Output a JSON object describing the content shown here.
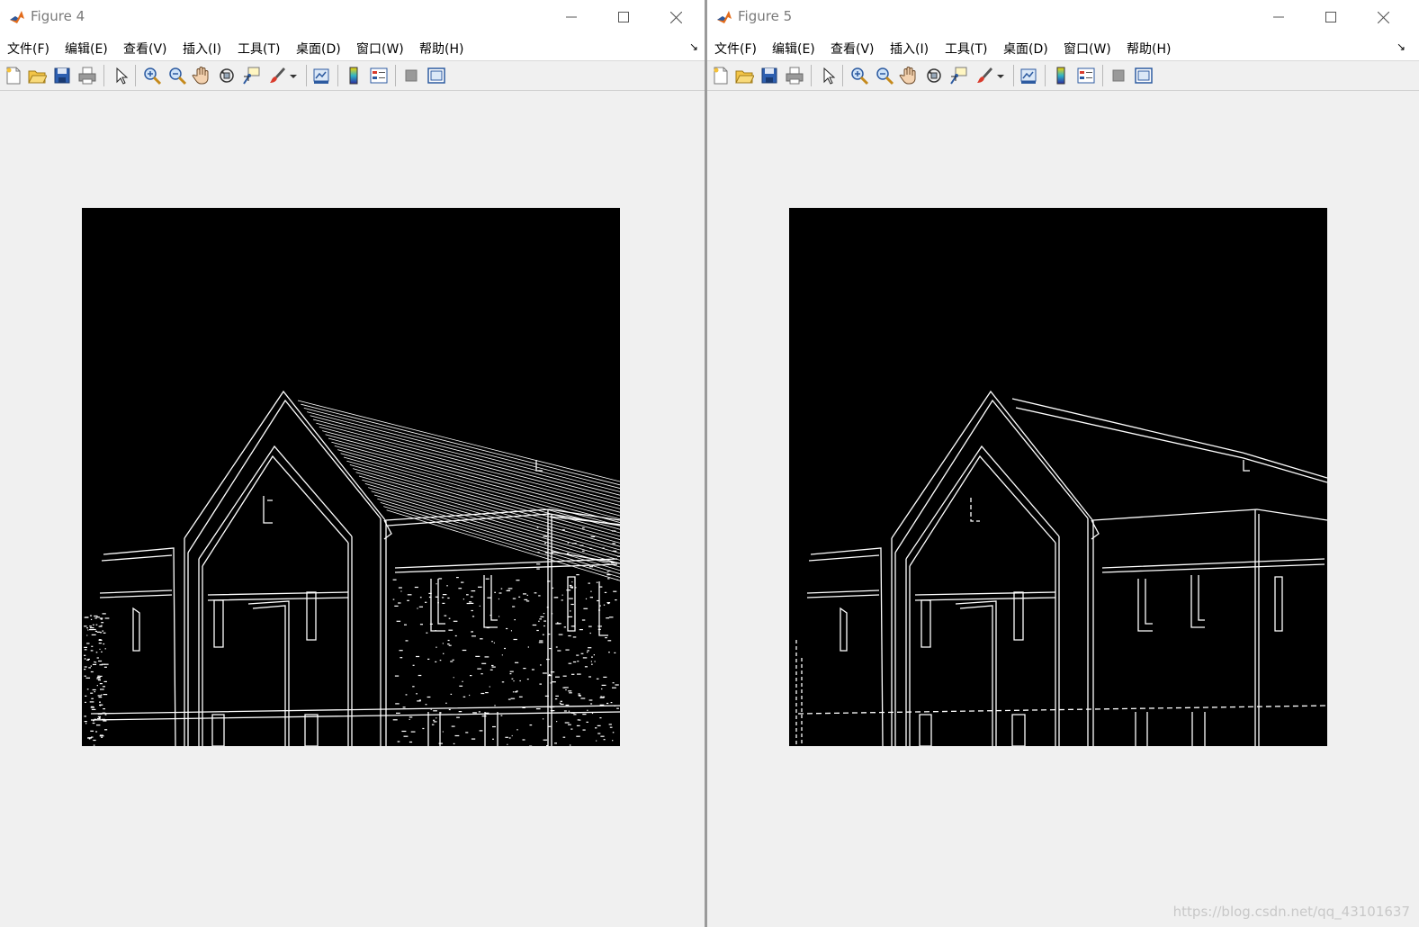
{
  "windows": [
    {
      "title": "Figure 4",
      "menu": [
        "文件(F)",
        "编辑(E)",
        "查看(V)",
        "插入(I)",
        "工具(T)",
        "桌面(D)",
        "窗口(W)",
        "帮助(H)"
      ],
      "menu_arrow": "↘",
      "toolbar_icons": [
        "new-figure-icon",
        "open-file-icon",
        "save-icon",
        "print-icon",
        "pointer-icon",
        "zoom-in-icon",
        "zoom-out-icon",
        "pan-hand-icon",
        "rotate-3d-icon",
        "data-cursor-icon",
        "brush-icon",
        "link-plot-icon",
        "colorbar-icon",
        "legend-icon",
        "hide-plot-tools-icon",
        "show-plot-tools-icon"
      ],
      "image": "edge detection result (fine, dense edges)"
    },
    {
      "title": "Figure 5",
      "menu": [
        "文件(F)",
        "编辑(E)",
        "查看(V)",
        "插入(I)",
        "工具(T)",
        "桌面(D)",
        "窗口(W)",
        "帮助(H)"
      ],
      "menu_arrow": "↘",
      "toolbar_icons": [
        "new-figure-icon",
        "open-file-icon",
        "save-icon",
        "print-icon",
        "pointer-icon",
        "zoom-in-icon",
        "zoom-out-icon",
        "pan-hand-icon",
        "rotate-3d-icon",
        "data-cursor-icon",
        "brush-icon",
        "link-plot-icon",
        "colorbar-icon",
        "legend-icon",
        "hide-plot-tools-icon",
        "show-plot-tools-icon"
      ],
      "image": "edge detection result (smoothed, sparse edges)"
    }
  ],
  "watermark": "https://blog.csdn.net/qq_43101637",
  "colors": {
    "matlab_orange": "#e36c1c",
    "matlab_blue": "#2c5aa0",
    "plot_bg": "#000000",
    "edge": "#ffffff"
  }
}
